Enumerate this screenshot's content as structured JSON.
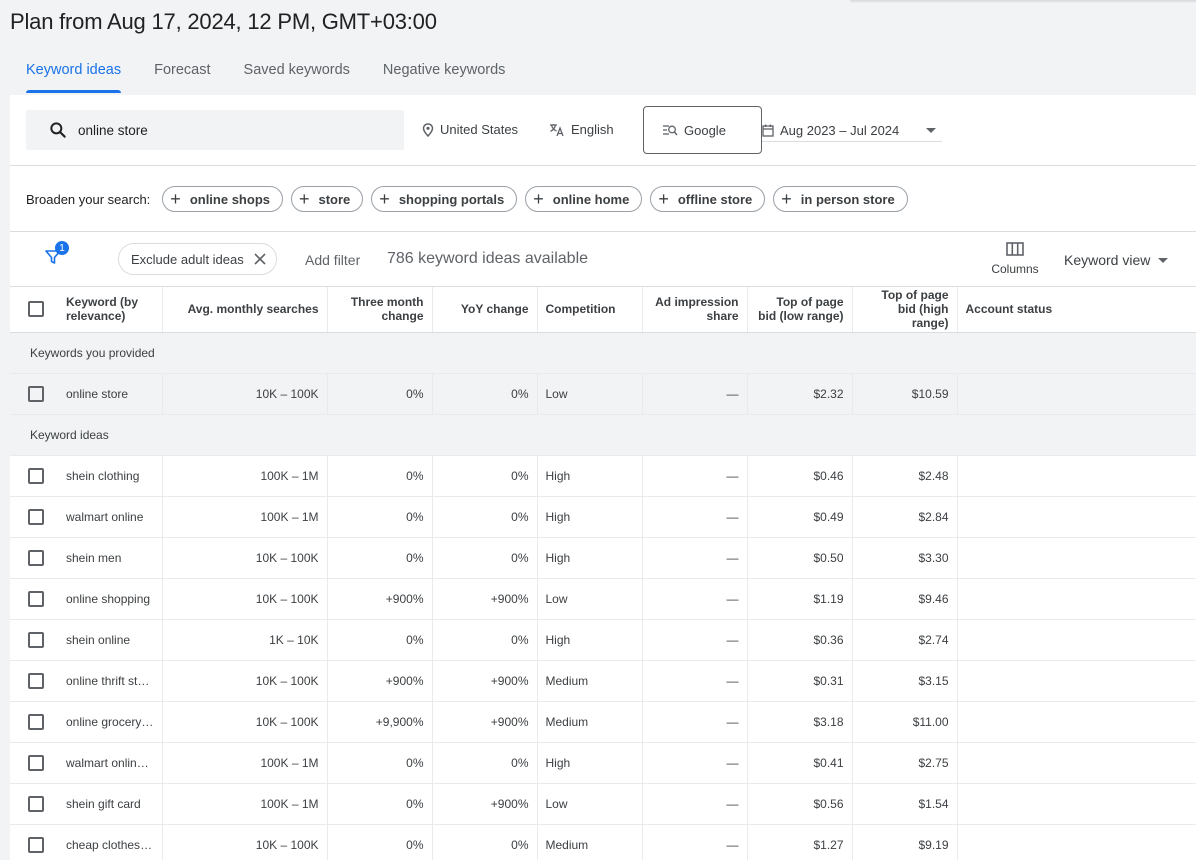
{
  "page_title": "Plan from Aug 17, 2024, 12 PM, GMT+03:00",
  "tabs": [
    {
      "label": "Keyword ideas",
      "active": true
    },
    {
      "label": "Forecast",
      "active": false
    },
    {
      "label": "Saved keywords",
      "active": false
    },
    {
      "label": "Negative keywords",
      "active": false
    }
  ],
  "search": {
    "value": "online store",
    "icon": "search-icon"
  },
  "location": {
    "label": "United States",
    "icon": "location-pin-icon"
  },
  "language": {
    "label": "English",
    "icon": "translate-icon"
  },
  "network": {
    "label": "Google",
    "icon": "search-network-icon"
  },
  "date_range": {
    "label": "Aug 2023 – Jul 2024",
    "icon": "calendar-icon"
  },
  "broaden": {
    "label": "Broaden your search:",
    "chips": [
      "online shops",
      "store",
      "shopping portals",
      "online home",
      "offline store",
      "in person store"
    ]
  },
  "toolbar": {
    "filter_badge": "1",
    "exclude_chip": "Exclude adult ideas",
    "add_filter": "Add filter",
    "count_text": "786 keyword ideas available",
    "columns_label": "Columns",
    "view_label": "Keyword view"
  },
  "table": {
    "headers": {
      "keyword": "Keyword (by relevance)",
      "avg": "Avg. monthly searches",
      "three_month": "Three month change",
      "yoy": "YoY change",
      "competition": "Competition",
      "impression": "Ad impression share",
      "bid_low": "Top of page bid (low range)",
      "bid_high": "Top of page bid (high range)",
      "status": "Account status"
    },
    "provided_group_label": "Keywords you provided",
    "ideas_group_label": "Keyword ideas",
    "provided": [
      {
        "keyword": "online store",
        "avg": "10K – 100K",
        "three_month": "0%",
        "yoy": "0%",
        "competition": "Low",
        "impression": "—",
        "bid_low": "$2.32",
        "bid_high": "$10.59",
        "status": ""
      }
    ],
    "ideas": [
      {
        "keyword": "shein clothing",
        "avg": "100K – 1M",
        "three_month": "0%",
        "yoy": "0%",
        "competition": "High",
        "impression": "—",
        "bid_low": "$0.46",
        "bid_high": "$2.48",
        "status": ""
      },
      {
        "keyword": "walmart online",
        "avg": "100K – 1M",
        "three_month": "0%",
        "yoy": "0%",
        "competition": "High",
        "impression": "—",
        "bid_low": "$0.49",
        "bid_high": "$2.84",
        "status": ""
      },
      {
        "keyword": "shein men",
        "avg": "10K – 100K",
        "three_month": "0%",
        "yoy": "0%",
        "competition": "High",
        "impression": "—",
        "bid_low": "$0.50",
        "bid_high": "$3.30",
        "status": ""
      },
      {
        "keyword": "online shopping",
        "avg": "10K – 100K",
        "three_month": "+900%",
        "yoy": "+900%",
        "competition": "Low",
        "impression": "—",
        "bid_low": "$1.19",
        "bid_high": "$9.46",
        "status": ""
      },
      {
        "keyword": "shein online",
        "avg": "1K – 10K",
        "three_month": "0%",
        "yoy": "0%",
        "competition": "High",
        "impression": "—",
        "bid_low": "$0.36",
        "bid_high": "$2.74",
        "status": ""
      },
      {
        "keyword": "online thrift st…",
        "avg": "10K – 100K",
        "three_month": "+900%",
        "yoy": "+900%",
        "competition": "Medium",
        "impression": "—",
        "bid_low": "$0.31",
        "bid_high": "$3.15",
        "status": ""
      },
      {
        "keyword": "online grocery …",
        "avg": "10K – 100K",
        "three_month": "+9,900%",
        "yoy": "+900%",
        "competition": "Medium",
        "impression": "—",
        "bid_low": "$3.18",
        "bid_high": "$11.00",
        "status": ""
      },
      {
        "keyword": "walmart online…",
        "avg": "100K – 1M",
        "three_month": "0%",
        "yoy": "0%",
        "competition": "High",
        "impression": "—",
        "bid_low": "$0.41",
        "bid_high": "$2.75",
        "status": ""
      },
      {
        "keyword": "shein gift card",
        "avg": "100K – 1M",
        "three_month": "0%",
        "yoy": "+900%",
        "competition": "Low",
        "impression": "—",
        "bid_low": "$0.56",
        "bid_high": "$1.54",
        "status": ""
      },
      {
        "keyword": "cheap clothes …",
        "avg": "10K – 100K",
        "three_month": "0%",
        "yoy": "0%",
        "competition": "Medium",
        "impression": "—",
        "bid_low": "$1.27",
        "bid_high": "$9.19",
        "status": ""
      }
    ]
  },
  "colors": {
    "accent": "#1a73e8",
    "background": "#f1f3f4",
    "panel": "#ffffff",
    "text": "#202124",
    "muted": "#5f6368"
  }
}
